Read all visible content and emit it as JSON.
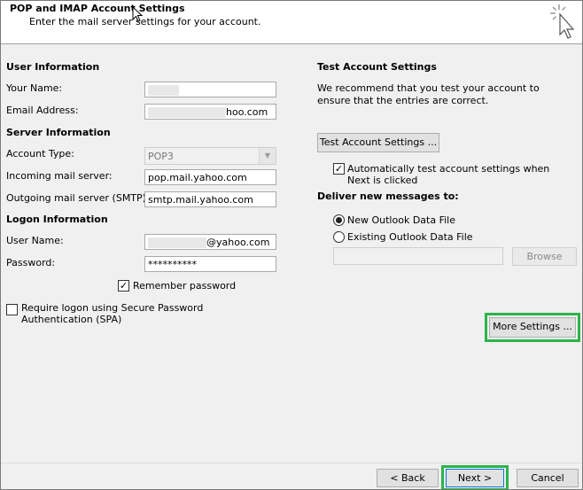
{
  "header": {
    "title": "POP and IMAP Account Settings",
    "subtitle": "Enter the mail server settings for your account."
  },
  "user_info": {
    "heading": "User Information",
    "your_name_label": "Your Name:",
    "your_name_value": "",
    "email_label": "Email Address:",
    "email_value_suffix": "hoo.com"
  },
  "server_info": {
    "heading": "Server Information",
    "account_type_label": "Account Type:",
    "account_type_value": "POP3",
    "incoming_label": "Incoming mail server:",
    "incoming_value": "pop.mail.yahoo.com",
    "outgoing_label": "Outgoing mail server (SMTP):",
    "outgoing_value": "smtp.mail.yahoo.com"
  },
  "logon_info": {
    "heading": "Logon Information",
    "username_label": "User Name:",
    "username_value_suffix": "@yahoo.com",
    "password_label": "Password:",
    "password_value": "**********",
    "remember_label": "Remember password",
    "remember_checked": true,
    "spa_label": "Require logon using Secure Password Authentication (SPA)",
    "spa_checked": false
  },
  "test_settings": {
    "heading": "Test Account Settings",
    "description": "We recommend that you test your account to ensure that the entries are correct.",
    "test_button": "Test Account Settings ...",
    "auto_test_label": "Automatically test account settings when Next is clicked",
    "auto_test_checked": true,
    "deliver_heading": "Deliver new messages to:",
    "new_file_label": "New Outlook Data File",
    "existing_file_label": "Existing Outlook Data File",
    "selected_option": "New Outlook Data File",
    "browse_button": "Browse",
    "more_settings_button": "More Settings ..."
  },
  "footer": {
    "back_button": "< Back",
    "next_button": "Next >",
    "cancel_button": "Cancel"
  },
  "colors": {
    "highlight": "#2eb34a",
    "panel_bg": "#f0f0f0"
  }
}
